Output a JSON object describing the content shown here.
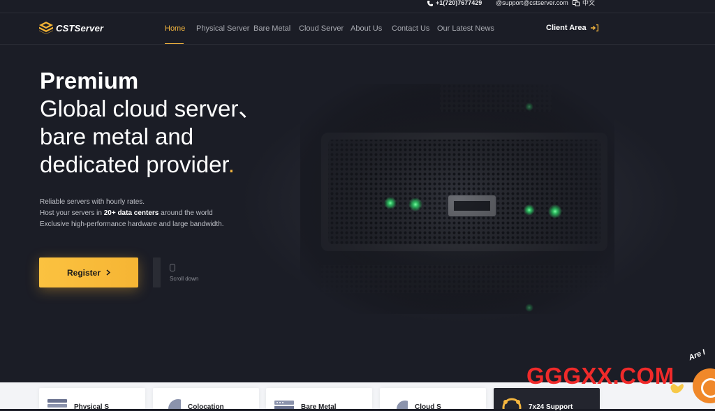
{
  "topbar": {
    "phone": "+1(720)7677429",
    "email": "@support@cstserver.com",
    "language": "中文"
  },
  "brand": {
    "name": "CSTServer",
    "accent": "#f4b63f"
  },
  "nav": {
    "items": [
      {
        "label": "Home",
        "active": true
      },
      {
        "label": "Physical Server"
      },
      {
        "label": "Bare Metal"
      },
      {
        "label": "Cloud Server"
      },
      {
        "label": "About Us"
      },
      {
        "label": "Contact Us"
      },
      {
        "label": "Our Latest News"
      }
    ],
    "client_area": "Client Area"
  },
  "hero": {
    "title_bold": "Premium",
    "title_lines": [
      "Global cloud server、",
      "bare metal and",
      "dedicated provider"
    ],
    "title_dot": ".",
    "desc_line1": "Reliable servers with hourly rates.",
    "desc_line2_pre": "Host your servers in ",
    "desc_line2_bold": "20+ data centers",
    "desc_line2_post": " around the world",
    "desc_line3": "Exclusive high-performance hardware and large bandwidth.",
    "register_label": "Register",
    "scroll_label": "Scroll down"
  },
  "cards": [
    {
      "label": "Physical S",
      "icon": "server-stack-icon"
    },
    {
      "label": "Colocation",
      "icon": "globe-icon"
    },
    {
      "label": "Bare Metal",
      "icon": "rack-icon"
    },
    {
      "label": "Cloud S",
      "icon": "cloud-icon"
    },
    {
      "label": "7x24 Support",
      "icon": "headset-icon"
    }
  ],
  "overlay": {
    "watermark": "GGGXX.COM",
    "chat_text": "Are I"
  }
}
